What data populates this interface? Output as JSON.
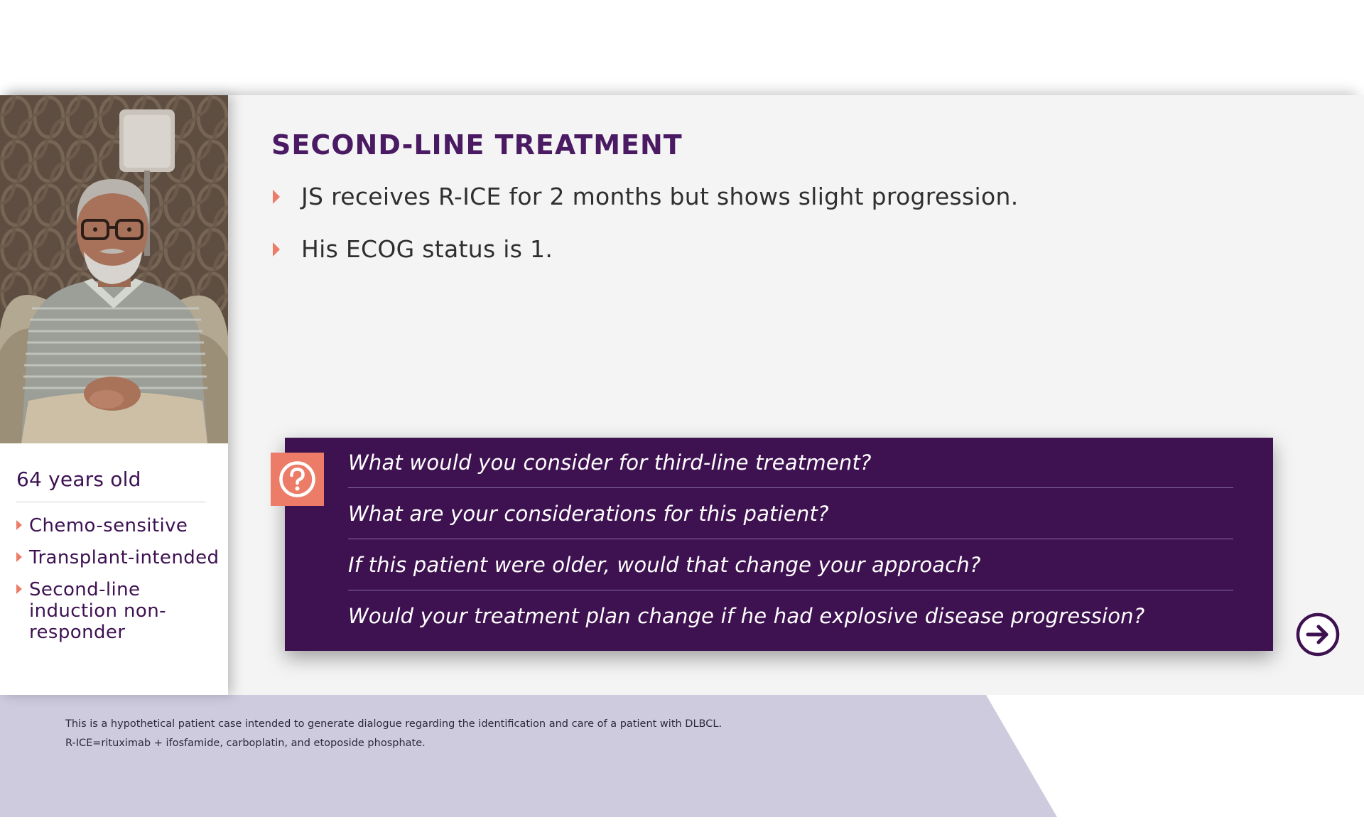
{
  "slide": {
    "title": "SECOND-LINE TREATMENT",
    "bullets": [
      "JS receives R-ICE for 2 months but shows slight progression.",
      "His ECOG status is 1."
    ]
  },
  "patient": {
    "age": "64 years old",
    "traits": [
      "Chemo-sensitive",
      "Transplant-intended",
      "Second-line induction non-responder"
    ]
  },
  "questions": [
    "What would you consider for third-line treatment?",
    "What are your considerations for this patient?",
    "If this patient were older, would that change your approach?",
    "Would your treatment plan change if he had explosive disease progression?"
  ],
  "footnotes": [
    "This is a hypothetical patient case intended to generate dialogue regarding the identification and care of a patient with DLBCL.",
    "R-ICE=rituximab + ifosfamide, carboplatin, and etoposide phosphate."
  ],
  "icons": {
    "question_badge": "question-mark-icon",
    "next_button": "arrow-right-circle-icon"
  },
  "colors": {
    "purple_dark": "#3e1150",
    "title_purple": "#4a1a63",
    "coral": "#ec7c68",
    "lavender": "#cfcbdf",
    "panel_gray": "#f4f4f4"
  }
}
